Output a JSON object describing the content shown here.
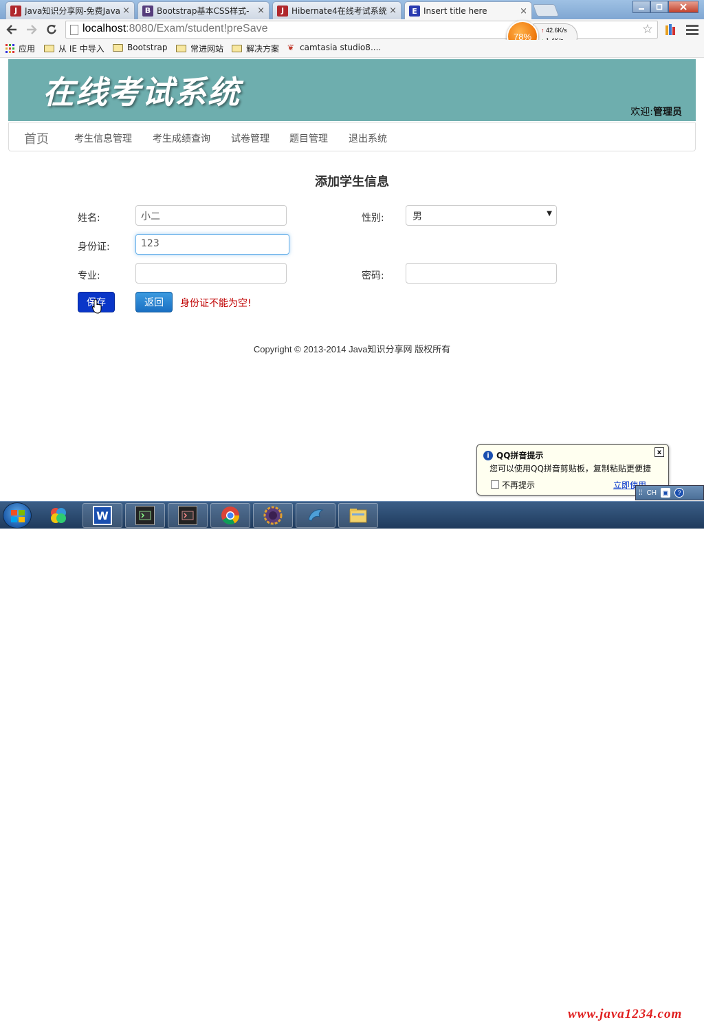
{
  "browser": {
    "tabs": [
      {
        "label": "Java知识分享网-免费Java",
        "icon_letter": "J",
        "icon_color": "#b0282d"
      },
      {
        "label": "Bootstrap基本CSS样式-",
        "icon_letter": "B",
        "icon_color": "#563d7c"
      },
      {
        "label": "Hibernate4在线考试系统",
        "icon_letter": "J",
        "icon_color": "#b0282d"
      },
      {
        "label": "Insert title here",
        "icon_letter": "E",
        "icon_color": "#2a3bb0"
      }
    ],
    "tab_close_glyph": "×",
    "url_host": "localhost",
    "url_path": ":8080/Exam/student!preSave",
    "speed": {
      "percent": "78%",
      "up": "42.6K/s",
      "down": "1.4K/s"
    },
    "bookmarks": [
      "应用",
      "从 IE 中导入",
      "Bootstrap",
      "常进网站",
      "解决方案",
      "camtasia studio8...."
    ]
  },
  "site": {
    "brand": "在线考试系统",
    "welcome_prefix": "欢迎:",
    "welcome_user": "管理员",
    "nav": {
      "home": "首页",
      "items": [
        "考生信息管理",
        "考生成绩查询",
        "试卷管理",
        "题目管理",
        "退出系统"
      ]
    }
  },
  "form": {
    "title": "添加学生信息",
    "name_label": "姓名:",
    "name_value": "小二",
    "gender_label": "性别:",
    "gender_value": "男",
    "id_label": "身份证:",
    "id_value": "123",
    "major_label": "专业:",
    "major_value": "",
    "password_label": "密码:",
    "password_value": "",
    "save_label": "保存",
    "back_label": "返回",
    "error": "身份证不能为空!"
  },
  "footer": "Copyright © 2013-2014 Java知识分享网 版权所有",
  "qq_popup": {
    "title": "QQ拼音提示",
    "body": "您可以使用QQ拼音剪贴板，复制粘贴更便捷",
    "checkbox_label": "不再提示",
    "link": "立即使用",
    "close_glyph": "x"
  },
  "ime_bar": {
    "lang": "CH"
  },
  "taskbar": {
    "watermark": "www.java1234.com"
  },
  "colors": {
    "banner": "#6eaeae",
    "save_button": "#0a36c8",
    "error": "#c00000"
  }
}
